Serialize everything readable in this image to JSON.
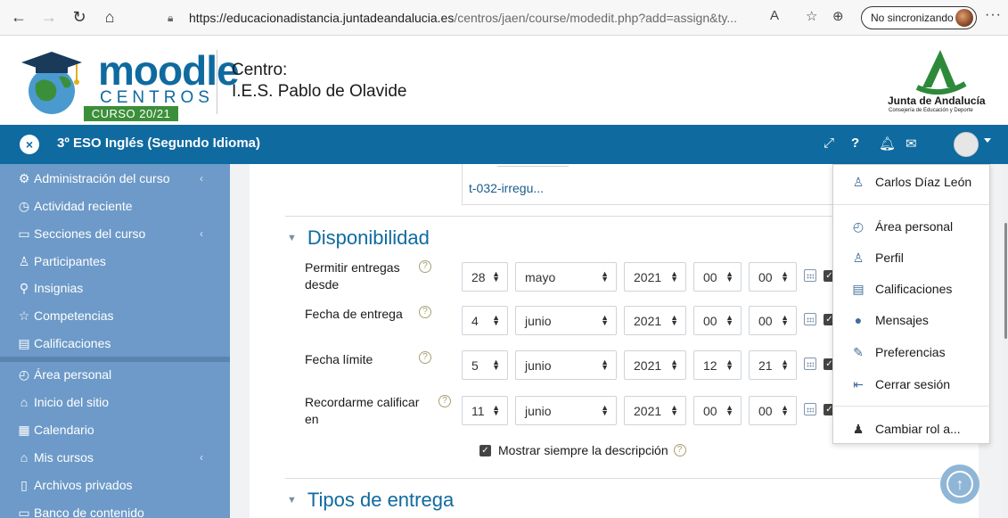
{
  "browser": {
    "url_host": "https://educacionadistancia.juntadeandalucia.es",
    "url_path": "/centros/jaen/course/modedit.php?add=assign&ty...",
    "sync_label": "No sincronizando",
    "more_label": "···"
  },
  "brand": {
    "moodle": "moodle",
    "centros": "CENTROS",
    "curso": "CURSO 20/21",
    "centro_label": "Centro:",
    "centro_name": "I.E.S. Pablo de Olavide",
    "junta_name": "Junta de Andalucía",
    "junta_sub": "Consejería de Educación y Deporte"
  },
  "navbar": {
    "close": "×",
    "course_title": "3º ESO Inglés (Segundo Idioma)"
  },
  "sidebar": {
    "items": [
      {
        "label": "Administración del curso",
        "icon": "gears-icon",
        "has_chevron": true
      },
      {
        "label": "Actividad reciente",
        "icon": "clock-icon",
        "has_chevron": false
      },
      {
        "label": "Secciones del curso",
        "icon": "folder-icon",
        "has_chevron": true
      },
      {
        "label": "Participantes",
        "icon": "users-icon",
        "has_chevron": false
      },
      {
        "label": "Insignias",
        "icon": "badge-icon",
        "has_chevron": false
      },
      {
        "label": "Competencias",
        "icon": "star-icon",
        "has_chevron": false
      },
      {
        "label": "Calificaciones",
        "icon": "gradebook-icon",
        "has_chevron": false
      },
      {
        "label": "Área personal",
        "icon": "dashboard-icon",
        "has_chevron": false
      },
      {
        "label": "Inicio del sitio",
        "icon": "home-icon",
        "has_chevron": false
      },
      {
        "label": "Calendario",
        "icon": "calendar-icon",
        "has_chevron": false
      },
      {
        "label": "Mis cursos",
        "icon": "graduation-cap-icon",
        "has_chevron": true
      },
      {
        "label": "Archivos privados",
        "icon": "files-icon",
        "has_chevron": false
      },
      {
        "label": "Banco de contenido",
        "icon": "folder-icon",
        "has_chevron": false
      }
    ],
    "chevron": "‹"
  },
  "main": {
    "file_name": "t-032-irregu...",
    "section_availability": "Disponibilidad",
    "section_submission": "Tipos de entrega",
    "rows": [
      {
        "label": "Permitir entregas desde",
        "day": "28",
        "month": "mayo",
        "year": "2021",
        "hour": "00",
        "minute": "00"
      },
      {
        "label": "Fecha de entrega",
        "day": "4",
        "month": "junio",
        "year": "2021",
        "hour": "00",
        "minute": "00"
      },
      {
        "label": "Fecha límite",
        "day": "5",
        "month": "junio",
        "year": "2021",
        "hour": "12",
        "minute": "21"
      },
      {
        "label": "Recordarme calificar en",
        "day": "11",
        "month": "junio",
        "year": "2021",
        "hour": "00",
        "minute": "00"
      }
    ],
    "show_description": "Mostrar siempre la descripción",
    "help": "?"
  },
  "user_menu": {
    "items": [
      {
        "label": "Carlos Díaz León",
        "icon": "user-icon"
      },
      {
        "label": "Área personal",
        "icon": "dashboard-icon"
      },
      {
        "label": "Perfil",
        "icon": "user-icon"
      },
      {
        "label": "Calificaciones",
        "icon": "gradebook-icon"
      },
      {
        "label": "Mensajes",
        "icon": "chat-icon"
      },
      {
        "label": "Preferencias",
        "icon": "wrench-icon"
      },
      {
        "label": "Cerrar sesión",
        "icon": "logout-icon"
      },
      {
        "label": "Cambiar rol a...",
        "icon": "user-secret-icon"
      }
    ]
  },
  "colors": {
    "navbar": "#0f6aa0",
    "sidebar": "#6d9ac8",
    "accent": "#0f6aa0"
  }
}
